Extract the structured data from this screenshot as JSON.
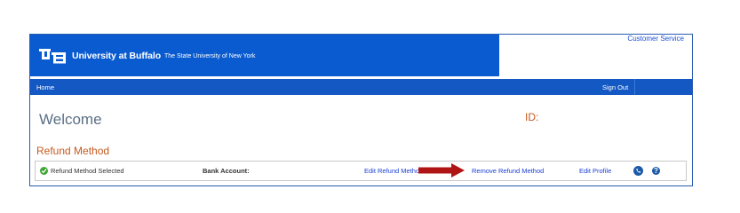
{
  "header": {
    "university_name": "University at Buffalo",
    "university_subtitle": "The State University of New York",
    "customer_service": "Customer Service"
  },
  "nav": {
    "home": "Home",
    "sign_out": "Sign Out"
  },
  "main": {
    "welcome": "Welcome",
    "id_label": "ID:",
    "section_title": "Refund Method"
  },
  "refund_row": {
    "status_text": "Refund Method Selected",
    "bank_account_label": "Bank Account:",
    "edit_refund_method": "Edit Refund Method",
    "remove_refund_method": "Remove Refund Method",
    "edit_profile": "Edit Profile",
    "help_glyph": "?"
  },
  "colors": {
    "banner": "#0a5bd0",
    "navbar": "#1458c4",
    "accent_orange": "#c55a1e",
    "link_blue": "#1a3fd6",
    "arrow_red": "#b01515",
    "check_green": "#3fa535"
  },
  "icons": [
    "ub-logo-icon",
    "check-circle-icon",
    "red-arrow-icon",
    "phone-icon",
    "help-icon"
  ]
}
